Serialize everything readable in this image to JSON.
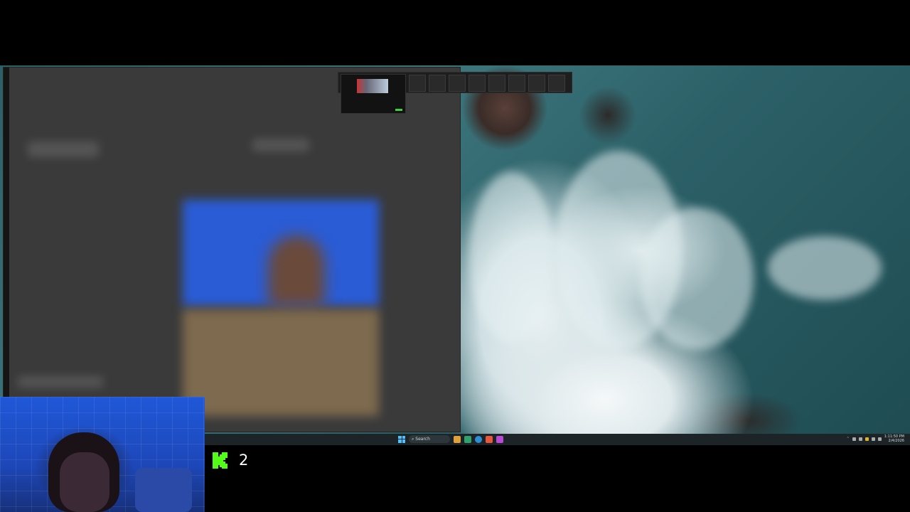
{
  "taskbar": {
    "search_label": "Search",
    "clock_time": "1:11:50 PM",
    "clock_date": "2/4/2026"
  },
  "stream_overlay": {
    "platform_icon": "kick-logo-icon",
    "viewer_count": "2",
    "accent_color": "#53fc18"
  },
  "colors": {
    "windows_blue": "#4cc2ff",
    "taskbar_bg": "#1c2428"
  }
}
